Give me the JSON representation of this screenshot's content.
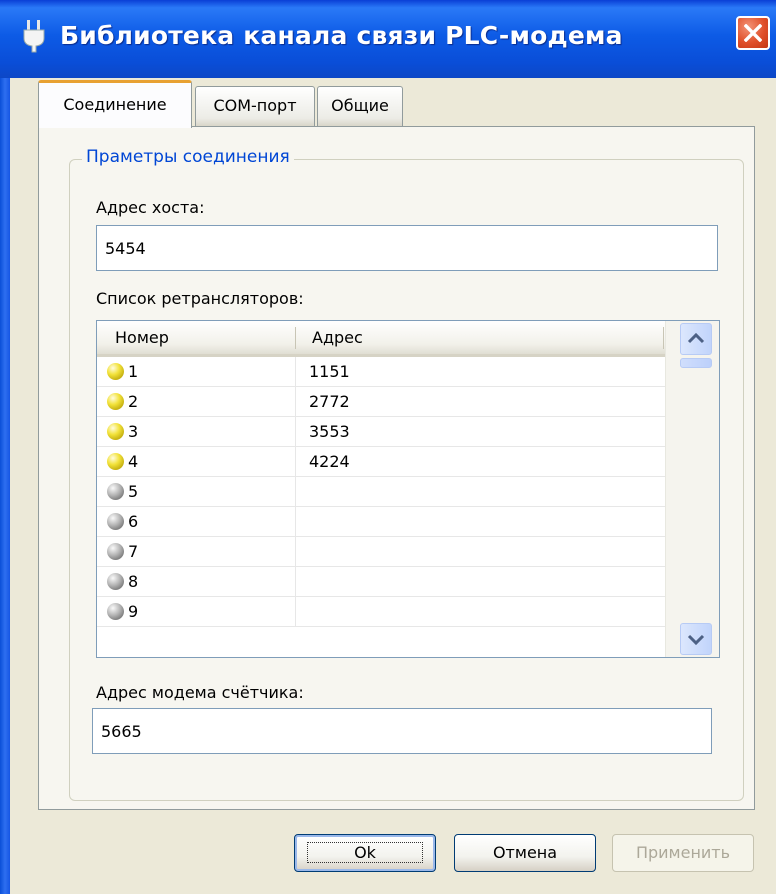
{
  "window": {
    "title": "Библиотека канала связи PLC-модема",
    "icon": "plug-icon",
    "close_icon": "close-icon",
    "accent": "#0a4ed8"
  },
  "tabs": [
    {
      "label": "Соединение",
      "active": true
    },
    {
      "label": "COM-порт",
      "active": false
    },
    {
      "label": "Общие",
      "active": false
    }
  ],
  "connection": {
    "group_title": "Праметры соединения",
    "host_label": "Адрес хоста:",
    "host_value": "5454",
    "repeaters_label": "Список ретрансляторов:",
    "columns": [
      "Номер",
      "Адрес"
    ],
    "rows": [
      {
        "num": "1",
        "addr": "1151",
        "status": "yellow"
      },
      {
        "num": "2",
        "addr": "2772",
        "status": "yellow"
      },
      {
        "num": "3",
        "addr": "3553",
        "status": "yellow"
      },
      {
        "num": "4",
        "addr": "4224",
        "status": "yellow"
      },
      {
        "num": "5",
        "addr": "",
        "status": "gray"
      },
      {
        "num": "6",
        "addr": "",
        "status": "gray"
      },
      {
        "num": "7",
        "addr": "",
        "status": "gray"
      },
      {
        "num": "8",
        "addr": "",
        "status": "gray"
      },
      {
        "num": "9",
        "addr": "",
        "status": "gray"
      }
    ],
    "meter_label": "Адрес модема счётчика:",
    "meter_value": "5665"
  },
  "buttons": {
    "ok": "Ok",
    "cancel": "Отмена",
    "apply": "Применить"
  }
}
